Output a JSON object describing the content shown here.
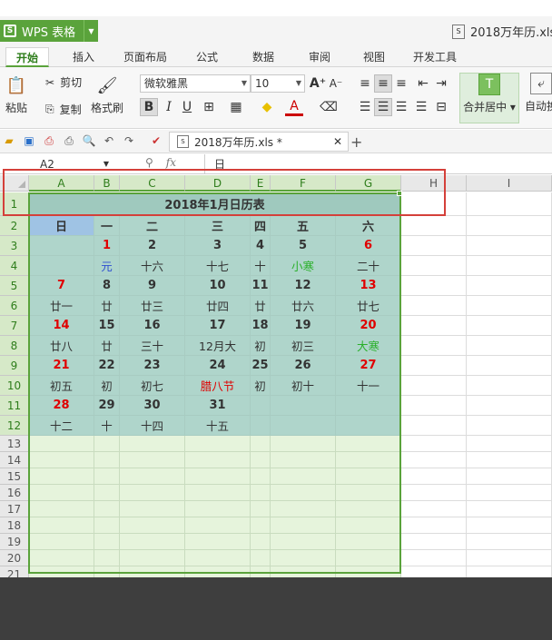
{
  "app": {
    "name": "WPS 表格",
    "logo_letter": "S",
    "doc_title": "2018万年历.xls",
    "accent": "#5aa33b"
  },
  "ribbon_tabs": [
    "开始",
    "插入",
    "页面布局",
    "公式",
    "数据",
    "审阅",
    "视图",
    "开发工具"
  ],
  "ribbon": {
    "paste": "粘贴",
    "cut": "剪切",
    "copy": "复制",
    "format_painter": "格式刷",
    "font_name": "微软雅黑",
    "font_size": "10",
    "merge_center": "合并居中",
    "auto_wrap": "自动换"
  },
  "doc_tab": {
    "label": "2018万年历.xls *"
  },
  "formula_bar": {
    "cell_ref": "A2",
    "fx": "fx",
    "content": "日"
  },
  "columns": [
    "A",
    "B",
    "C",
    "D",
    "E",
    "F",
    "G",
    "H",
    "I"
  ],
  "rows": [
    "1",
    "2",
    "3",
    "4",
    "5",
    "6",
    "7",
    "8",
    "9",
    "10",
    "11",
    "12",
    "13",
    "14",
    "15",
    "16",
    "17",
    "18",
    "19",
    "20",
    "21"
  ],
  "calendar": {
    "title": "2018年1月日历表",
    "weekdays": [
      "日",
      "一",
      "二",
      "三",
      "四",
      "五",
      "六"
    ],
    "grid": [
      [
        {
          "t": ""
        },
        {
          "t": "1",
          "c": "red"
        },
        {
          "t": "2"
        },
        {
          "t": "3"
        },
        {
          "t": "4"
        },
        {
          "t": "5"
        },
        {
          "t": "6",
          "c": "red"
        }
      ],
      [
        {
          "t": ""
        },
        {
          "t": "元",
          "c": "blu"
        },
        {
          "t": "十六"
        },
        {
          "t": "十七"
        },
        {
          "t": "十"
        },
        {
          "t": "小寒",
          "c": "grn"
        },
        {
          "t": "二十"
        }
      ],
      [
        {
          "t": "7",
          "c": "red"
        },
        {
          "t": "8"
        },
        {
          "t": "9"
        },
        {
          "t": "10"
        },
        {
          "t": "11"
        },
        {
          "t": "12"
        },
        {
          "t": "13",
          "c": "red"
        }
      ],
      [
        {
          "t": "廿一"
        },
        {
          "t": "廿"
        },
        {
          "t": "廿三"
        },
        {
          "t": "廿四"
        },
        {
          "t": "廿"
        },
        {
          "t": "廿六"
        },
        {
          "t": "廿七"
        }
      ],
      [
        {
          "t": "14",
          "c": "red"
        },
        {
          "t": "15"
        },
        {
          "t": "16"
        },
        {
          "t": "17"
        },
        {
          "t": "18"
        },
        {
          "t": "19"
        },
        {
          "t": "20",
          "c": "red"
        }
      ],
      [
        {
          "t": "廿八"
        },
        {
          "t": "廿"
        },
        {
          "t": "三十"
        },
        {
          "t": "12月大"
        },
        {
          "t": "初"
        },
        {
          "t": "初三"
        },
        {
          "t": "大寒",
          "c": "grn"
        }
      ],
      [
        {
          "t": "21",
          "c": "red"
        },
        {
          "t": "22"
        },
        {
          "t": "23"
        },
        {
          "t": "24"
        },
        {
          "t": "25"
        },
        {
          "t": "26"
        },
        {
          "t": "27",
          "c": "red"
        }
      ],
      [
        {
          "t": "初五"
        },
        {
          "t": "初"
        },
        {
          "t": "初七"
        },
        {
          "t": "腊八节",
          "c": "red"
        },
        {
          "t": "初"
        },
        {
          "t": "初十"
        },
        {
          "t": "十一"
        }
      ],
      [
        {
          "t": "28",
          "c": "red"
        },
        {
          "t": "29"
        },
        {
          "t": "30"
        },
        {
          "t": "31"
        },
        {
          "t": ""
        },
        {
          "t": ""
        },
        {
          "t": ""
        }
      ],
      [
        {
          "t": "十二"
        },
        {
          "t": "十"
        },
        {
          "t": "十四"
        },
        {
          "t": "十五"
        },
        {
          "t": ""
        },
        {
          "t": ""
        },
        {
          "t": ""
        }
      ]
    ]
  },
  "colors": {
    "teal": "#afd5cb",
    "light_green": "#e6f4dc",
    "holiday_red": "#e00000",
    "solar_term_green": "#2ab02a"
  }
}
